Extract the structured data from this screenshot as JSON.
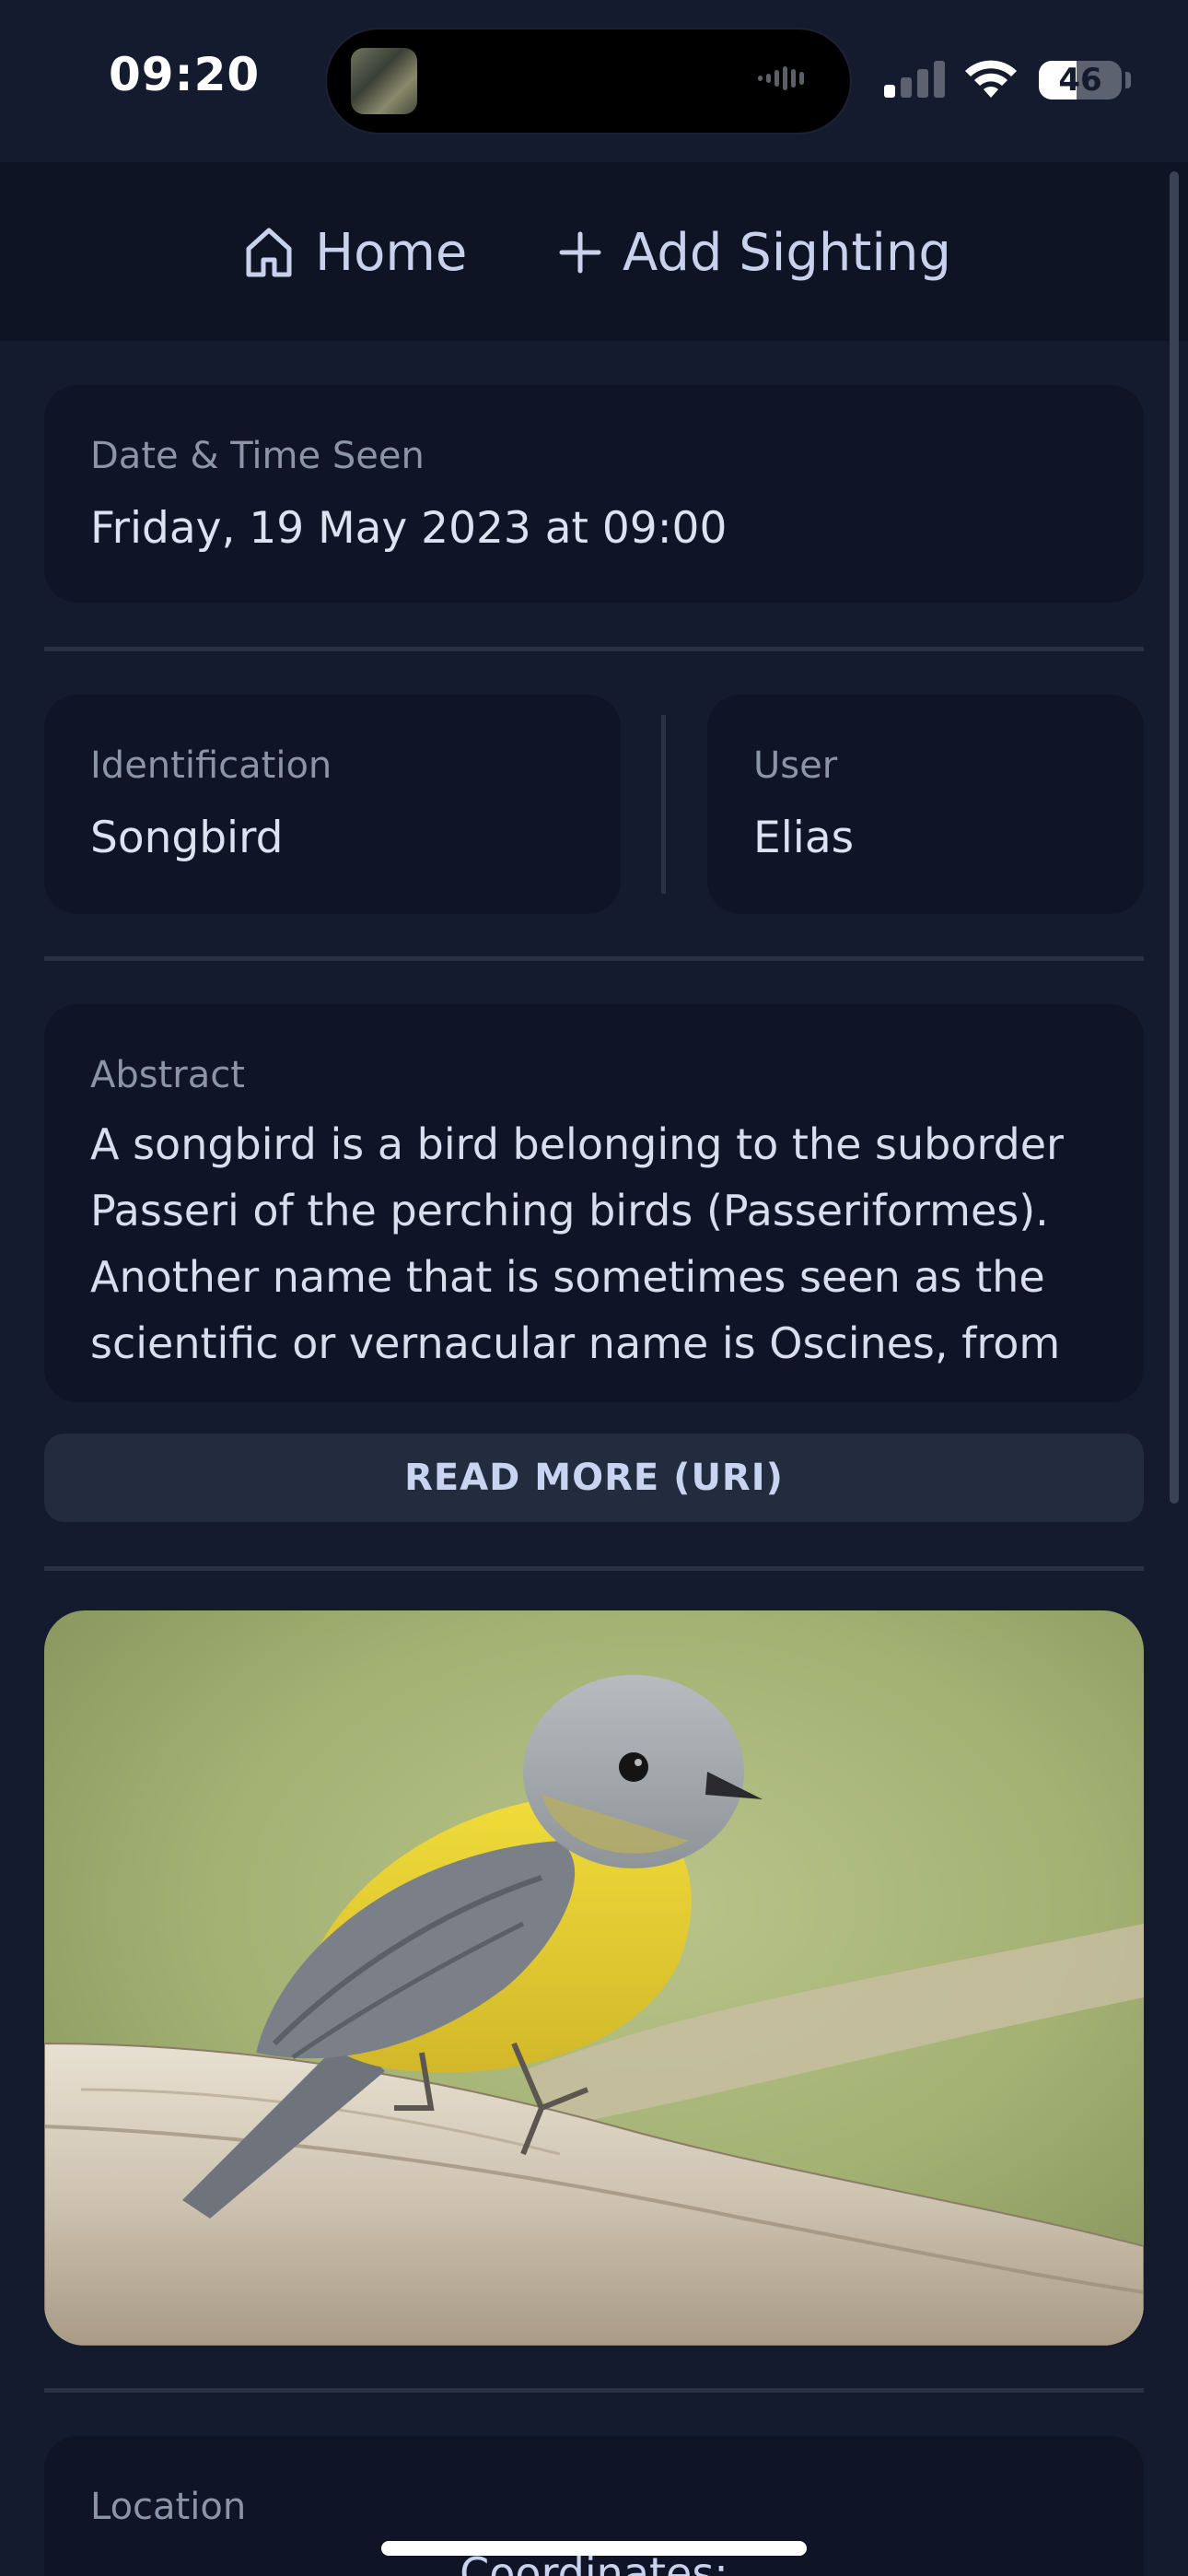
{
  "status": {
    "time": "09:20",
    "battery": "46",
    "battery_level": 0.46
  },
  "nav": {
    "home_label": "Home",
    "add_label": "Add Sighting"
  },
  "sighting": {
    "date_label": "Date & Time Seen",
    "date_value": "Friday, 19 May 2023 at 09:00",
    "identification_label": "Identification",
    "identification_value": "Songbird",
    "user_label": "User",
    "user_value": "Elias",
    "abstract_label": "Abstract",
    "abstract_text": "A songbird is a bird belonging to the suborder Passeri of the perching birds (Passeriformes). Another name that is sometimes seen as the scientific or vernacular name is Oscines, from Latin oscen, \"songbird\". The Passeriformes",
    "read_more_label": "READ MORE (URI)",
    "location_label": "Location",
    "coordinates_label": "Coordinates:"
  },
  "icons": {
    "home": "home-icon",
    "add": "plus-icon",
    "signal": "cellular-signal-icon",
    "wifi": "wifi-icon",
    "battery": "battery-icon"
  }
}
